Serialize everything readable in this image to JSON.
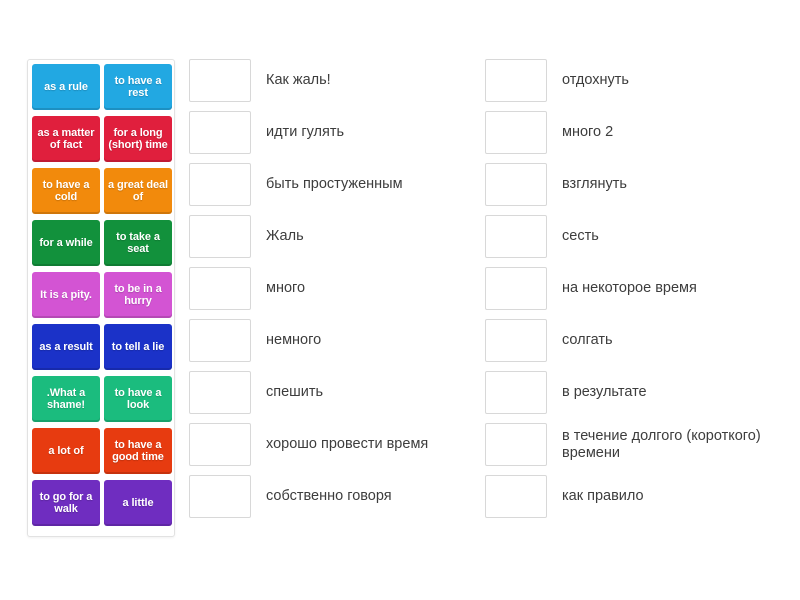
{
  "activity": {
    "type": "match-up",
    "background_color": "#ffffff"
  },
  "tile_panel": {
    "name": "draggable-answer-tiles",
    "tiles": [
      {
        "label": "as a rule",
        "color": "#22a8e2"
      },
      {
        "label": "to have a rest",
        "color": "#22a8e2"
      },
      {
        "label": "as a matter of fact",
        "color": "#e01f3d"
      },
      {
        "label": "for a long (short) time",
        "color": "#e01f3d"
      },
      {
        "label": "to have a cold",
        "color": "#f28a0c"
      },
      {
        "label": "a great deal of",
        "color": "#f28a0c"
      },
      {
        "label": "for a while",
        "color": "#12913c"
      },
      {
        "label": "to take a seat",
        "color": "#12913c"
      },
      {
        "label": "It is a pity.",
        "color": "#d354d3"
      },
      {
        "label": "to be in a hurry",
        "color": "#d354d3"
      },
      {
        "label": "as a result",
        "color": "#1b32c8"
      },
      {
        "label": "to tell a lie",
        "color": "#1b32c8"
      },
      {
        "label": ".What a shame!",
        "color": "#1bbc7e"
      },
      {
        "label": "to have a look",
        "color": "#1bbc7e"
      },
      {
        "label": "a lot of",
        "color": "#e73b10"
      },
      {
        "label": "to have a good time",
        "color": "#e73b10"
      },
      {
        "label": "to go for a walk",
        "color": "#6f2dc0"
      },
      {
        "label": "a little",
        "color": "#6f2dc0"
      }
    ]
  },
  "match_columns": [
    {
      "name": "match-column-left",
      "rows": [
        {
          "drop_value": "",
          "label": "Как жаль!"
        },
        {
          "drop_value": "",
          "label": "идти гулять"
        },
        {
          "drop_value": "",
          "label": "быть простуженным"
        },
        {
          "drop_value": "",
          "label": "Жаль"
        },
        {
          "drop_value": "",
          "label": "много"
        },
        {
          "drop_value": "",
          "label": "немного"
        },
        {
          "drop_value": "",
          "label": "спешить"
        },
        {
          "drop_value": "",
          "label": "хорошо провести время"
        },
        {
          "drop_value": "",
          "label": "собственно говоря"
        }
      ]
    },
    {
      "name": "match-column-right",
      "rows": [
        {
          "drop_value": "",
          "label": "отдохнуть"
        },
        {
          "drop_value": "",
          "label": "много 2"
        },
        {
          "drop_value": "",
          "label": "взглянуть"
        },
        {
          "drop_value": "",
          "label": "сесть"
        },
        {
          "drop_value": "",
          "label": "на некоторое время"
        },
        {
          "drop_value": "",
          "label": "солгать"
        },
        {
          "drop_value": "",
          "label": "в результате"
        },
        {
          "drop_value": "",
          "label": "в течение долгого (короткого) времени"
        },
        {
          "drop_value": "",
          "label": "как правило"
        }
      ]
    }
  ]
}
